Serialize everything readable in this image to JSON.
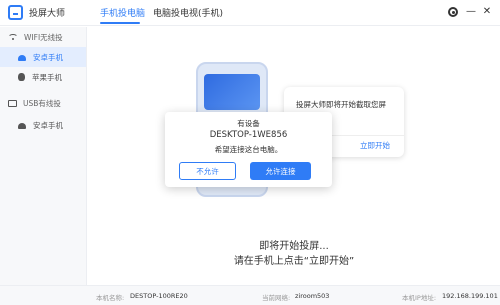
{
  "app": {
    "title": "投屏大师"
  },
  "tabs": [
    {
      "label": "手机投电脑"
    },
    {
      "label": "电脑投电视(手机)"
    }
  ],
  "window_controls": {
    "minimize": "—",
    "close": "✕"
  },
  "sidebar": {
    "wifi_section": "WIFI无线投",
    "wifi_items": [
      {
        "label": "安卓手机"
      },
      {
        "label": "苹果手机"
      }
    ],
    "usb_section": "USB有线投",
    "usb_items": [
      {
        "label": "安卓手机"
      }
    ]
  },
  "hint_card": {
    "text": "投屏大师即将开始截取您屏幕…容。",
    "button": "立即开始"
  },
  "dialog": {
    "line1": "有设备",
    "device": "DESKTOP-1WE856",
    "line3": "希望连接这台电脑。",
    "deny_label": "不允许",
    "allow_label": "允许连接"
  },
  "waiting": {
    "line1": "即将开始投屏...",
    "line2": "请在手机上点击“立即开始”"
  },
  "status": {
    "name_label": "本机名称:",
    "name_value": "DESTOP-100RE20",
    "network_label": "当前网络:",
    "network_value": "ziroom503",
    "ip_label": "本机IP地址:",
    "ip_value": "192.168.199.101"
  },
  "colors": {
    "accent": "#2f7cf6",
    "sidebar_active": "#e3edfe"
  }
}
